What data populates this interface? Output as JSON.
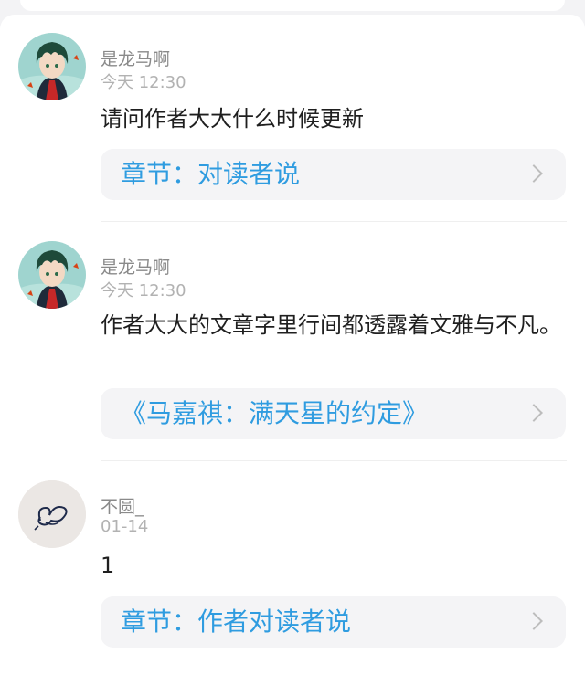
{
  "comments": [
    {
      "username": "是龙马啊",
      "timestamp": "今天 12:30",
      "content": "请问作者大大什么时候更新",
      "link_label": "章节：对读者说"
    },
    {
      "username": "是龙马啊",
      "timestamp": "今天 12:30",
      "content": "作者大大的文章字里行间都透露着文雅与不凡。",
      "link_label": "《马嘉祺：满天星的约定》"
    },
    {
      "username": "不圆_",
      "timestamp": "01-14",
      "content": "1",
      "link_label": "章节：作者对读者说"
    }
  ],
  "colors": {
    "link": "#2f9ce0",
    "username": "#8a8a8a",
    "timestamp": "#b2b2b2"
  },
  "icons": [
    "avatar-anime-boy",
    "avatar-butterfly-sketch",
    "chevron-right-icon"
  ]
}
